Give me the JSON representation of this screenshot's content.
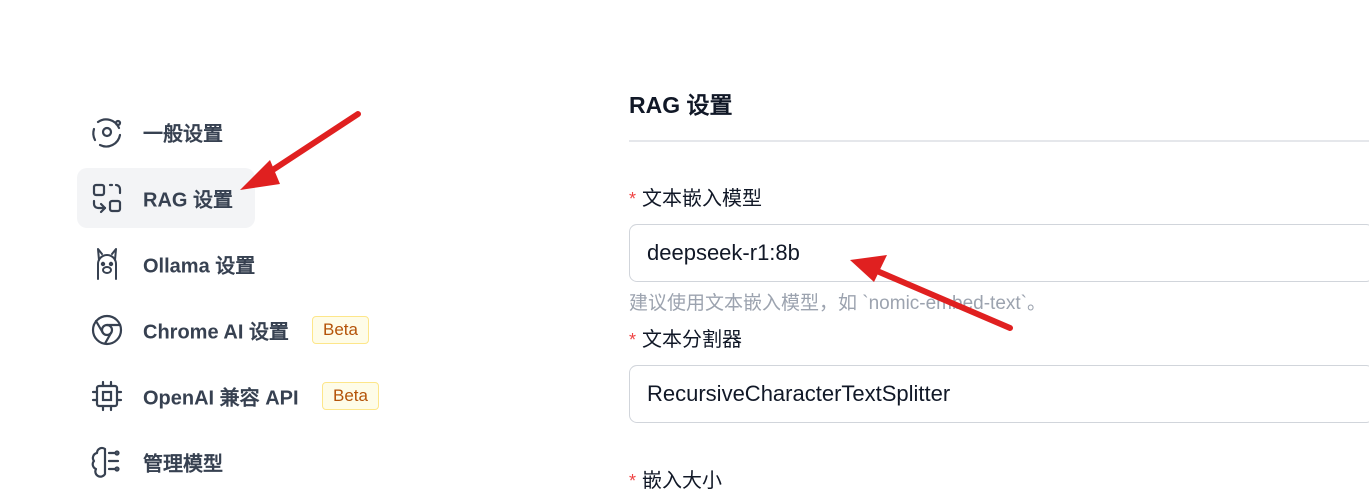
{
  "sidebar": {
    "items": [
      {
        "label": "一般设置",
        "icon": "settings-orbit-icon"
      },
      {
        "label": "RAG 设置",
        "icon": "rag-icon",
        "active": true
      },
      {
        "label": "Ollama 设置",
        "icon": "llama-icon"
      },
      {
        "label": "Chrome AI 设置",
        "icon": "chrome-icon",
        "badge": "Beta"
      },
      {
        "label": "OpenAI 兼容 API",
        "icon": "chip-icon",
        "badge": "Beta"
      },
      {
        "label": "管理模型",
        "icon": "brain-icon"
      }
    ]
  },
  "main": {
    "title": "RAG 设置",
    "fields": {
      "embedding_model": {
        "required_mark": "*",
        "label": "文本嵌入模型",
        "value": "deepseek-r1:8b",
        "help": "建议使用文本嵌入模型，如 `nomic-embed-text`。"
      },
      "splitter": {
        "required_mark": "*",
        "label": "文本分割器",
        "value": "RecursiveCharacterTextSplitter"
      },
      "chunk_size": {
        "required_mark": "*",
        "label": "嵌入大小"
      }
    }
  },
  "colors": {
    "annotation_arrow": "#e02020",
    "active_bg": "#f3f4f6",
    "required": "#ef4444",
    "badge_bg": "#fefce8",
    "badge_border": "#fde68a",
    "badge_text": "#b45309"
  }
}
